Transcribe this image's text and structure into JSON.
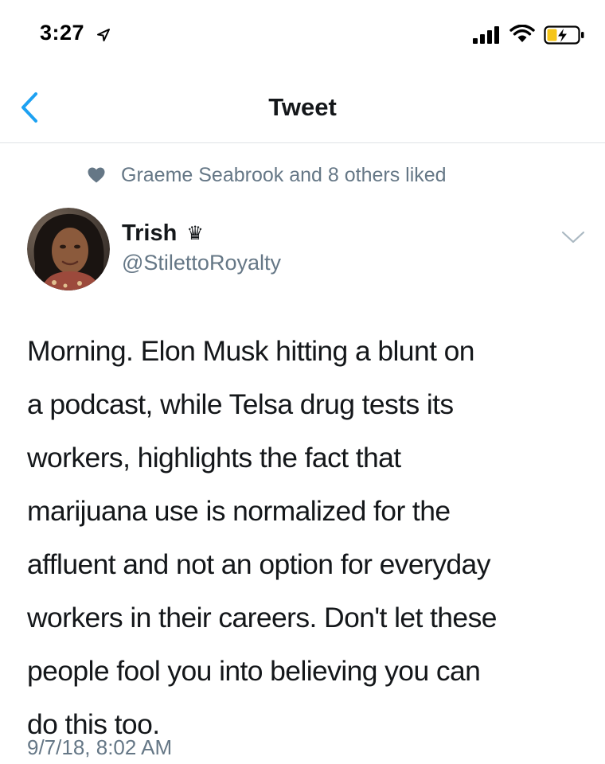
{
  "status_bar": {
    "time": "3:27",
    "icons": [
      "location-arrow-icon",
      "cellular-signal-icon",
      "wifi-icon",
      "battery-charging-icon"
    ],
    "battery_color": "#f5c518"
  },
  "nav": {
    "title": "Tweet",
    "back_icon": "chevron-left-icon",
    "accent_color": "#1da1f2"
  },
  "social_context": {
    "icon": "heart-icon",
    "text": "Graeme Seabrook and 8 others liked"
  },
  "tweet": {
    "author": {
      "name": "Trish",
      "badge": "♛",
      "handle": "@StilettoRoyalty",
      "avatar": "avatar-photo"
    },
    "text": "Morning. Elon Musk hitting a blunt on\na podcast, while Telsa drug tests its\nworkers, highlights the fact that\nmarijuana use is normalized for the\naffluent and not an option for everyday\nworkers in their careers. Don't let these\npeople fool you into believing you can\ndo this too.",
    "timestamp": "9/7/18, 8:02 AM",
    "menu_icon": "chevron-down-icon"
  }
}
